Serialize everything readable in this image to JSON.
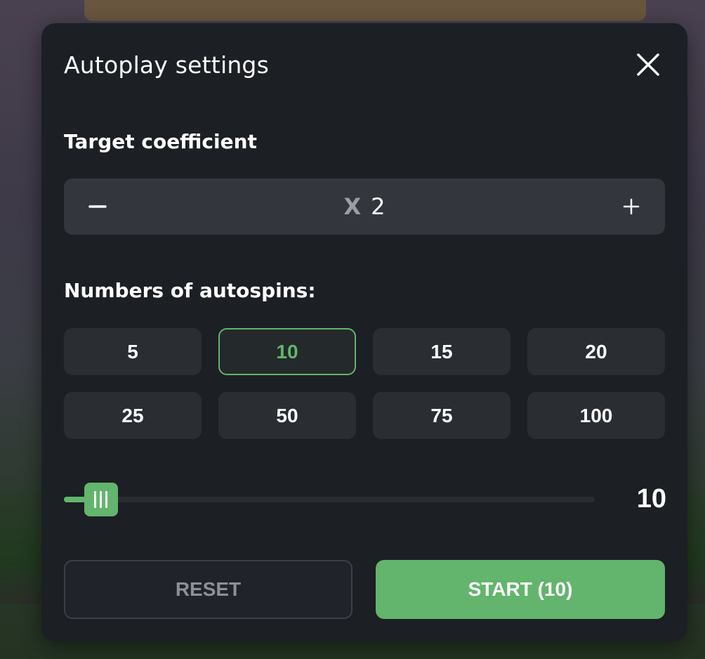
{
  "modal": {
    "title": "Autoplay settings"
  },
  "coefficient": {
    "label": "Target coefficient",
    "prefix": "X",
    "value": "2",
    "minus_icon": "minus-icon",
    "plus_icon": "plus-icon"
  },
  "autospins": {
    "label": "Numbers of autospins:",
    "options": [
      "5",
      "10",
      "15",
      "20",
      "25",
      "50",
      "75",
      "100"
    ],
    "selected": "10"
  },
  "slider": {
    "value": "10",
    "fraction": 0.07
  },
  "actions": {
    "reset_label": "RESET",
    "start_label": "START (10)"
  },
  "colors": {
    "accent": "#63b46c",
    "panel": "#1c1f23",
    "input_bg": "#33373d",
    "button_bg": "#2a2d32"
  }
}
